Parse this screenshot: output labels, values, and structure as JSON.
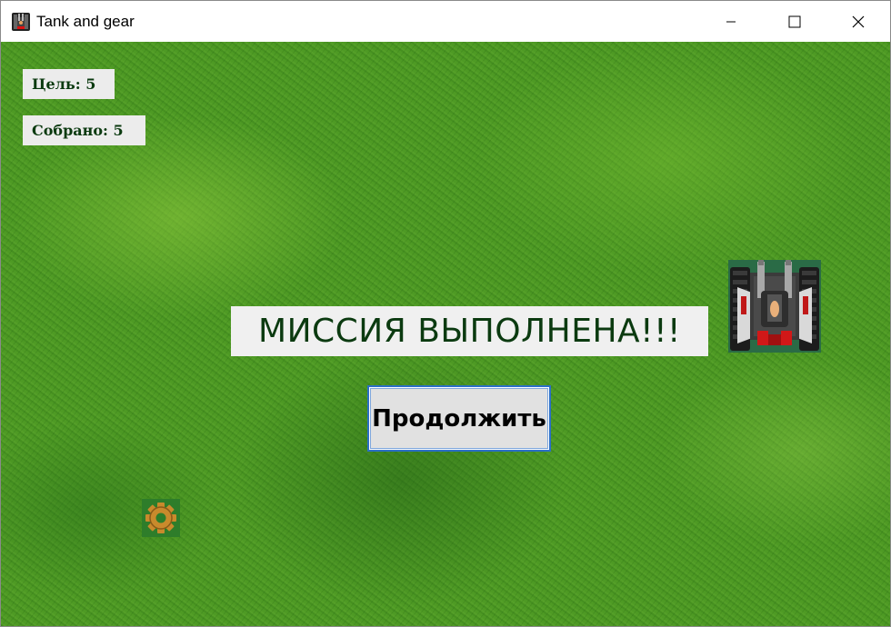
{
  "window": {
    "title": "Tank and gear",
    "app_icon": "tank-app-icon",
    "controls": {
      "minimize_icon": "minimize-icon",
      "maximize_icon": "maximize-icon",
      "close_icon": "close-icon"
    }
  },
  "hud": {
    "goal_label": "Цель: 5",
    "collected_label": "Собрано: 5"
  },
  "mission": {
    "banner_text": "МИССИЯ ВЫПОЛНЕНА!!!",
    "continue_label": "Продолжить"
  },
  "sprites": {
    "player": "tank-icon",
    "pickup": "gear-icon"
  },
  "colors": {
    "grass": "#4e9a24",
    "label_text": "#0b3a10",
    "label_background": "#ececec",
    "button_border": "#2c6fc7"
  }
}
